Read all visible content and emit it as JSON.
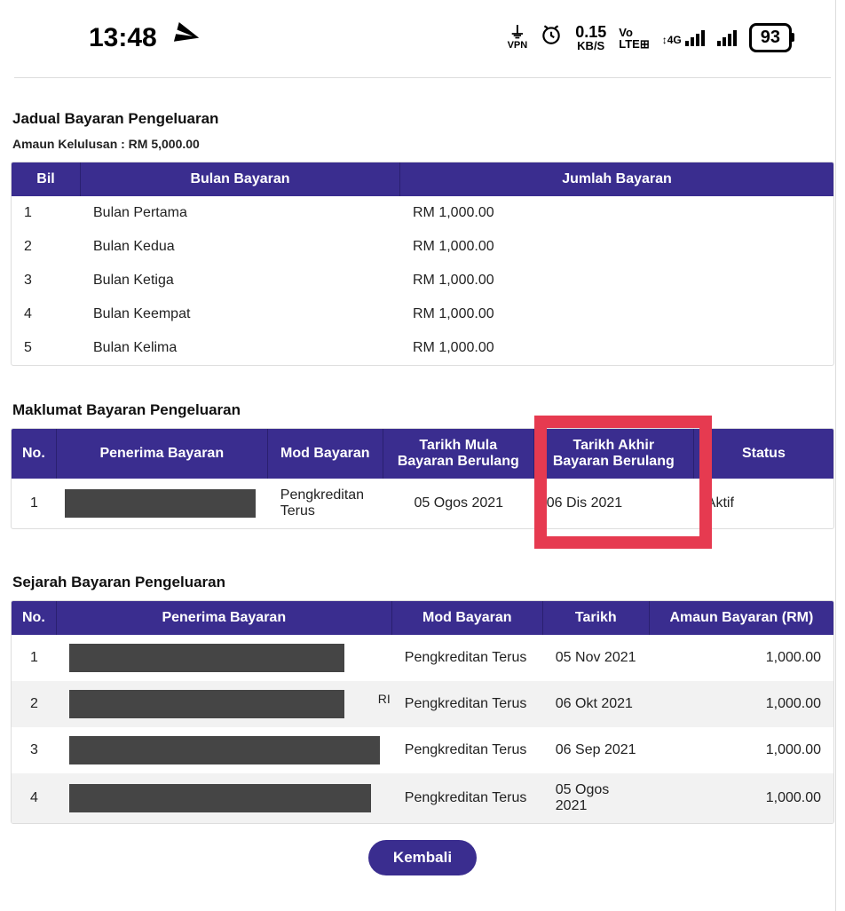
{
  "status": {
    "time": "13:48",
    "kbs_top": "0.15",
    "kbs_bot": "KB/S",
    "vo": "Vo",
    "lte": "LTE",
    "net": "4G",
    "battery": "93",
    "vpn": "VPN"
  },
  "section1": {
    "title": "Jadual Bayaran Pengeluaran",
    "subline": "Amaun Kelulusan : RM 5,000.00",
    "headers": {
      "bil": "Bil",
      "bulan": "Bulan Bayaran",
      "jumlah": "Jumlah Bayaran"
    },
    "rows": [
      {
        "bil": "1",
        "bulan": "Bulan Pertama",
        "jumlah": "RM 1,000.00"
      },
      {
        "bil": "2",
        "bulan": "Bulan Kedua",
        "jumlah": "RM 1,000.00"
      },
      {
        "bil": "3",
        "bulan": "Bulan Ketiga",
        "jumlah": "RM 1,000.00"
      },
      {
        "bil": "4",
        "bulan": "Bulan Keempat",
        "jumlah": "RM 1,000.00"
      },
      {
        "bil": "5",
        "bulan": "Bulan Kelima",
        "jumlah": "RM 1,000.00"
      }
    ]
  },
  "section2": {
    "title": "Maklumat Bayaran Pengeluaran",
    "headers": {
      "no": "No.",
      "penerima": "Penerima Bayaran",
      "mod": "Mod Bayaran",
      "mula": "Tarikh Mula Bayaran Berulang",
      "akhir": "Tarikh Akhir Bayaran Berulang",
      "status": "Status"
    },
    "rows": [
      {
        "no": "1",
        "penerima": "",
        "mod": "Pengkreditan Terus",
        "mula": "05 Ogos 2021",
        "akhir": "06 Dis 2021",
        "status": "Aktif"
      }
    ]
  },
  "section3": {
    "title": "Sejarah Bayaran Pengeluaran",
    "headers": {
      "no": "No.",
      "penerima": "Penerima Bayaran",
      "mod": "Mod Bayaran",
      "tarikh": "Tarikh",
      "amaun": "Amaun Bayaran (RM)"
    },
    "rows": [
      {
        "no": "1",
        "penerima": "",
        "mod": "Pengkreditan Terus",
        "tarikh": "05 Nov 2021",
        "amaun": "1,000.00"
      },
      {
        "no": "2",
        "penerima": "",
        "mod": "Pengkreditan Terus",
        "tarikh": "06 Okt 2021",
        "amaun": "1,000.00"
      },
      {
        "no": "3",
        "penerima": "",
        "mod": "Pengkreditan Terus",
        "tarikh": "06 Sep 2021",
        "amaun": "1,000.00"
      },
      {
        "no": "4",
        "penerima": "",
        "mod": "Pengkreditan Terus",
        "tarikh": "05 Ogos 2021",
        "amaun": "1,000.00"
      }
    ]
  },
  "button": {
    "kembali": "Kembali"
  }
}
